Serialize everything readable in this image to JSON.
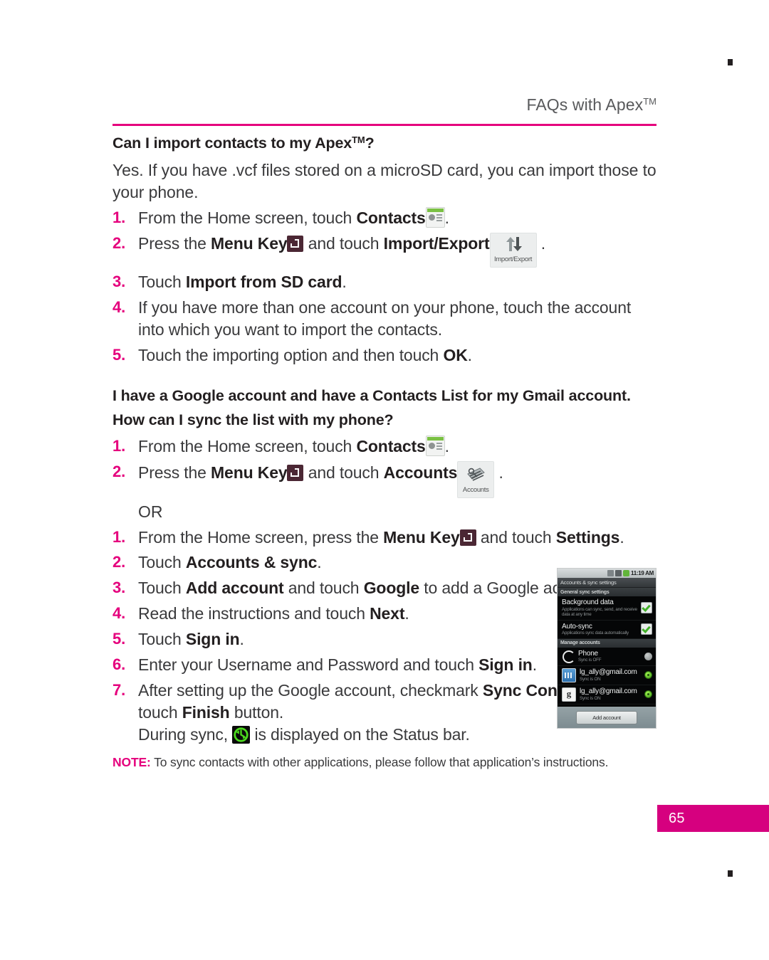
{
  "colors": {
    "accent_magenta": "#e5007d",
    "page_tab_magenta": "#d6007f",
    "body_text": "#3a3a3c",
    "heading_text": "#231f20"
  },
  "running_head": {
    "text": "FAQs with Apex",
    "superscript": "TM"
  },
  "faq1": {
    "heading_before": "Can I import contacts to my Apex",
    "heading_superscript": "TM",
    "heading_after": "?",
    "answer": "Yes. If you have .vcf files stored on a microSD card, you can import those to your phone.",
    "steps": [
      {
        "num": "1.",
        "parts": [
          {
            "t": "From the Home screen, touch ",
            "b": false
          },
          {
            "t": "Contacts",
            "b": true
          },
          {
            "icon": "contacts-app-icon"
          },
          {
            "t": ".",
            "b": false
          }
        ]
      },
      {
        "num": "2.",
        "parts": [
          {
            "t": "Press the ",
            "b": false
          },
          {
            "t": "Menu Key",
            "b": true
          },
          {
            "icon": "menu-key-icon"
          },
          {
            "t": " and touch ",
            "b": false
          },
          {
            "t": "Import/Export",
            "b": true
          },
          {
            "icon": "import-export-icon"
          },
          {
            "t": " .",
            "b": false
          }
        ]
      },
      {
        "num": "3.",
        "parts": [
          {
            "t": "Touch ",
            "b": false
          },
          {
            "t": "Import from SD card",
            "b": true
          },
          {
            "t": ".",
            "b": false
          }
        ]
      },
      {
        "num": "4.",
        "parts": [
          {
            "t": "If you have more than one account on your phone, touch the account into which you want to import the contacts.",
            "b": false
          }
        ]
      },
      {
        "num": "5.",
        "parts": [
          {
            "t": "Touch the importing option and then touch ",
            "b": false
          },
          {
            "t": "OK",
            "b": true
          },
          {
            "t": ".",
            "b": false
          }
        ]
      }
    ]
  },
  "faq2": {
    "heading_line1": "I have a Google account and have a Contacts List for my Gmail account.",
    "heading_line2": "How can I sync the list with my phone?",
    "steps_a": [
      {
        "num": "1.",
        "parts": [
          {
            "t": "From the Home screen, touch ",
            "b": false
          },
          {
            "t": "Contacts",
            "b": true
          },
          {
            "icon": "contacts-app-icon"
          },
          {
            "t": ".",
            "b": false
          }
        ]
      },
      {
        "num": "2.",
        "parts": [
          {
            "t": "Press the ",
            "b": false
          },
          {
            "t": "Menu Key",
            "b": true
          },
          {
            "icon": "menu-key-icon"
          },
          {
            "t": " and touch ",
            "b": false
          },
          {
            "t": "Accounts",
            "b": true
          },
          {
            "icon": "accounts-icon"
          },
          {
            "t": " .",
            "b": false
          }
        ]
      }
    ],
    "or_text": "OR",
    "steps_b": [
      {
        "num": "1.",
        "parts": [
          {
            "t": "From the Home screen, press the ",
            "b": false
          },
          {
            "t": "Menu Key",
            "b": true
          },
          {
            "icon": "menu-key-icon"
          },
          {
            "t": " and touch ",
            "b": false
          },
          {
            "t": "Settings",
            "b": true
          },
          {
            "t": ".",
            "b": false
          }
        ]
      },
      {
        "num": "2.",
        "parts": [
          {
            "t": "Touch ",
            "b": false
          },
          {
            "t": "Accounts & sync",
            "b": true
          },
          {
            "t": ".",
            "b": false
          }
        ]
      },
      {
        "num": "3.",
        "parts": [
          {
            "t": "Touch ",
            "b": false
          },
          {
            "t": "Add account",
            "b": true
          },
          {
            "t": " and touch ",
            "b": false
          },
          {
            "t": "Google",
            "b": true
          },
          {
            "t": " to add a Google account.",
            "b": false
          }
        ]
      },
      {
        "num": "4.",
        "parts": [
          {
            "t": "Read the instructions and touch ",
            "b": false
          },
          {
            "t": "Next",
            "b": true
          },
          {
            "t": ".",
            "b": false
          }
        ]
      },
      {
        "num": "5.",
        "parts": [
          {
            "t": "Touch ",
            "b": false
          },
          {
            "t": "Sign in",
            "b": true
          },
          {
            "t": ".",
            "b": false
          }
        ]
      },
      {
        "num": "6.",
        "parts": [
          {
            "t": "Enter your Username and Password and touch ",
            "b": false
          },
          {
            "t": "Sign in",
            "b": true
          },
          {
            "t": ".",
            "b": false
          }
        ]
      },
      {
        "num": "7.",
        "parts": [
          {
            "t": "After setting up the Google account, checkmark ",
            "b": false
          },
          {
            "t": "Sync Contacts",
            "b": true
          },
          {
            "t": " and touch ",
            "b": false
          },
          {
            "t": "Finish",
            "b": true
          },
          {
            "t": " button.",
            "b": false
          }
        ]
      }
    ],
    "sub_line": {
      "before": "During sync, ",
      "icon": "sync-status-icon",
      "after": " is displayed on the Status bar."
    }
  },
  "note": {
    "label": "NOTE:",
    "text": " To sync contacts with other applications, please follow that application’s instructions."
  },
  "phone_screenshot": {
    "status_bar": {
      "time": "11:19 AM",
      "icons": [
        "sd-card-icon",
        "signal-icon",
        "battery-icon"
      ]
    },
    "title_bar": "Accounts & sync settings",
    "sections": [
      {
        "header": "General sync settings",
        "rows": [
          {
            "title": "Background data",
            "subtitle": "Applications can sync, send, and receive data at any time",
            "control": "checkbox-checked"
          },
          {
            "title": "Auto-sync",
            "subtitle": "Applications sync data automatically",
            "control": "checkbox-checked"
          }
        ]
      },
      {
        "header": "Manage accounts",
        "rows": [
          {
            "icon": "phone-account-icon",
            "title": "Phone",
            "subtitle": "Sync is OFF",
            "control": "sync-dot-off"
          },
          {
            "icon": "gtalk-account-icon",
            "title": "lg_ally@gmail.com",
            "subtitle": "Sync is ON",
            "control": "sync-dot-on"
          },
          {
            "icon": "google-account-icon",
            "icon_glyph": "g",
            "title": "lg_ally@gmail.com",
            "subtitle": "Sync is ON",
            "control": "sync-dot-on"
          }
        ]
      }
    ],
    "footer_button": "Add account"
  },
  "page_number": "65",
  "import_export_chip_label": "Import/Export",
  "accounts_chip_label": "Accounts"
}
